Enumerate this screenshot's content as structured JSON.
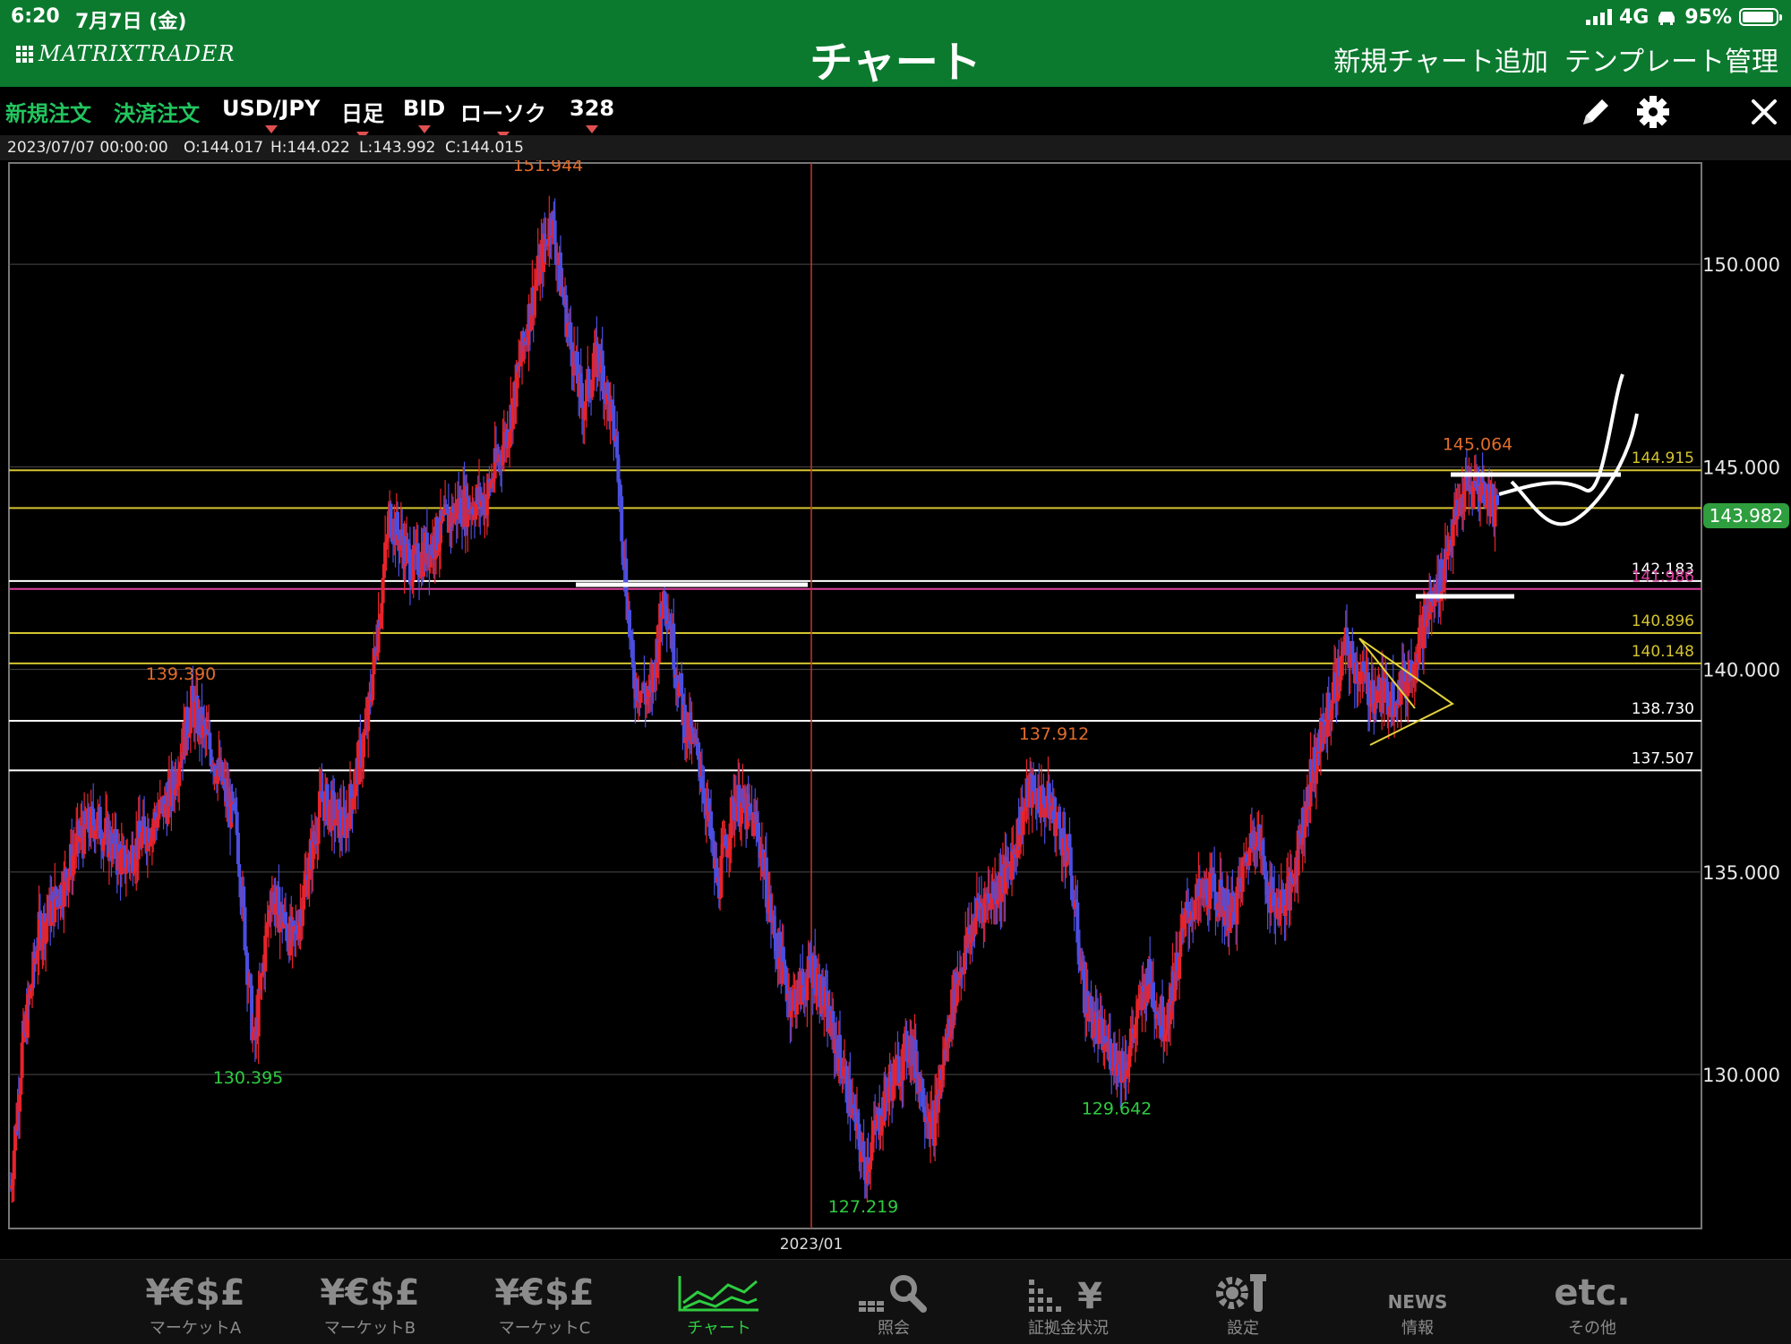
{
  "status_bar": {
    "time": "6:20",
    "date": "7月7日 (金)",
    "network": "4G",
    "battery": "95%"
  },
  "header": {
    "logo": "MATRIXTRADER",
    "title": "チャート",
    "actions": [
      "新規チャート追加",
      "テンプレート管理"
    ]
  },
  "toolbar": {
    "new_order": "新規注文",
    "close_order": "決済注文",
    "pair": "USD/JPY",
    "timeframe": "日足",
    "price_type": "BID",
    "chart_style": "ローソク",
    "bar_count": "328"
  },
  "ohlc": {
    "datetime": "2023/07/07 00:00:00",
    "open": "O:144.017",
    "high": "H:144.022",
    "low": "L:143.992",
    "close": "C:144.015"
  },
  "chart_data": {
    "type": "candlestick",
    "symbol": "USD/JPY",
    "y_range": [
      126.2,
      152.5
    ],
    "y_ticks": [
      150,
      145,
      140,
      135,
      130
    ],
    "y_tick_labels": [
      "150.000",
      "145.000",
      "140.000",
      "135.000",
      "130.000"
    ],
    "x_label": "2023/01",
    "current_price": "143.982",
    "marker_labels": [
      {
        "text": "151.944",
        "value": 151.944,
        "kind": "high"
      },
      {
        "text": "139.390",
        "value": 139.39,
        "kind": "high"
      },
      {
        "text": "137.912",
        "value": 137.912,
        "kind": "high"
      },
      {
        "text": "145.064",
        "value": 145.064,
        "kind": "high"
      },
      {
        "text": "130.395",
        "value": 130.395,
        "kind": "low"
      },
      {
        "text": "127.219",
        "value": 127.219,
        "kind": "low"
      },
      {
        "text": "129.642",
        "value": 129.642,
        "kind": "low"
      }
    ],
    "level_lines": [
      {
        "value": 144.915,
        "label": "144.915",
        "color": "#d4c430"
      },
      {
        "value": 143.982,
        "label": "",
        "color": "#d4c430"
      },
      {
        "value": 142.183,
        "label": "142.183",
        "color": "#ffffff"
      },
      {
        "value": 141.986,
        "label": "141.986",
        "color": "#e040a0"
      },
      {
        "value": 140.896,
        "label": "140.896",
        "color": "#d4c430"
      },
      {
        "value": 140.148,
        "label": "140.148",
        "color": "#d4c430"
      },
      {
        "value": 138.73,
        "label": "138.730",
        "color": "#ffffff"
      },
      {
        "value": 137.507,
        "label": "137.507",
        "color": "#ffffff"
      }
    ],
    "waypoints": [
      [
        0,
        127.2
      ],
      [
        10,
        130.6
      ],
      [
        25,
        133.5
      ],
      [
        45,
        134.6
      ],
      [
        60,
        135.8
      ],
      [
        75,
        136.3
      ],
      [
        100,
        135.2
      ],
      [
        120,
        136.0
      ],
      [
        140,
        136.8
      ],
      [
        160,
        139.1
      ],
      [
        180,
        137.8
      ],
      [
        200,
        136.0
      ],
      [
        215,
        130.6
      ],
      [
        230,
        134.5
      ],
      [
        250,
        133.2
      ],
      [
        275,
        136.8
      ],
      [
        295,
        136.1
      ],
      [
        315,
        138.6
      ],
      [
        335,
        143.8
      ],
      [
        355,
        142.5
      ],
      [
        375,
        143.2
      ],
      [
        395,
        144.0
      ],
      [
        420,
        144.2
      ],
      [
        440,
        146.0
      ],
      [
        460,
        149.0
      ],
      [
        478,
        151.2
      ],
      [
        488,
        149.2
      ],
      [
        505,
        146.5
      ],
      [
        520,
        147.8
      ],
      [
        535,
        145.6
      ],
      [
        550,
        139.8
      ],
      [
        565,
        139.2
      ],
      [
        578,
        142.0
      ],
      [
        595,
        138.8
      ],
      [
        610,
        137.6
      ],
      [
        625,
        134.6
      ],
      [
        640,
        136.8
      ],
      [
        660,
        136.1
      ],
      [
        675,
        133.4
      ],
      [
        690,
        131.8
      ],
      [
        710,
        132.6
      ],
      [
        735,
        130.2
      ],
      [
        755,
        127.7
      ],
      [
        775,
        129.6
      ],
      [
        795,
        130.8
      ],
      [
        815,
        128.6
      ],
      [
        835,
        132.2
      ],
      [
        855,
        134.1
      ],
      [
        880,
        134.9
      ],
      [
        900,
        137.0
      ],
      [
        920,
        136.6
      ],
      [
        935,
        135.4
      ],
      [
        950,
        131.8
      ],
      [
        965,
        130.8
      ],
      [
        985,
        130.2
      ],
      [
        1005,
        132.4
      ],
      [
        1020,
        131.2
      ],
      [
        1040,
        134.0
      ],
      [
        1060,
        134.6
      ],
      [
        1080,
        133.9
      ],
      [
        1100,
        136.2
      ],
      [
        1115,
        134.2
      ],
      [
        1130,
        134.4
      ],
      [
        1150,
        137.4
      ],
      [
        1165,
        139.0
      ],
      [
        1180,
        140.5
      ],
      [
        1200,
        139.5
      ],
      [
        1220,
        139.3
      ],
      [
        1235,
        139.8
      ],
      [
        1250,
        141.2
      ],
      [
        1262,
        142.0
      ],
      [
        1272,
        143.2
      ],
      [
        1285,
        144.4
      ],
      [
        1300,
        144.5
      ],
      [
        1310,
        144.1
      ],
      [
        1314,
        143.98
      ]
    ],
    "colors": {
      "up": "#e8232a",
      "down": "#4b4fe0",
      "grid": "#4a4a4a",
      "high_label": "#e06c2a",
      "low_label": "#2ecc40",
      "price_badge": "#2e9e3e"
    }
  },
  "tabs": [
    {
      "label": "マーケットA",
      "glyph": "¥€$£",
      "active": false
    },
    {
      "label": "マーケットB",
      "glyph": "¥€$£",
      "active": false
    },
    {
      "label": "マーケットC",
      "glyph": "¥€$£",
      "active": false
    },
    {
      "label": "チャート",
      "glyph": "chart",
      "active": true
    },
    {
      "label": "照会",
      "glyph": "search",
      "active": false
    },
    {
      "label": "証拠金状況",
      "glyph": "margin",
      "active": false
    },
    {
      "label": "設定",
      "glyph": "settings",
      "active": false
    },
    {
      "label": "情報",
      "glyph": "NEWS",
      "active": false
    },
    {
      "label": "その他",
      "glyph": "etc.",
      "active": false
    }
  ]
}
